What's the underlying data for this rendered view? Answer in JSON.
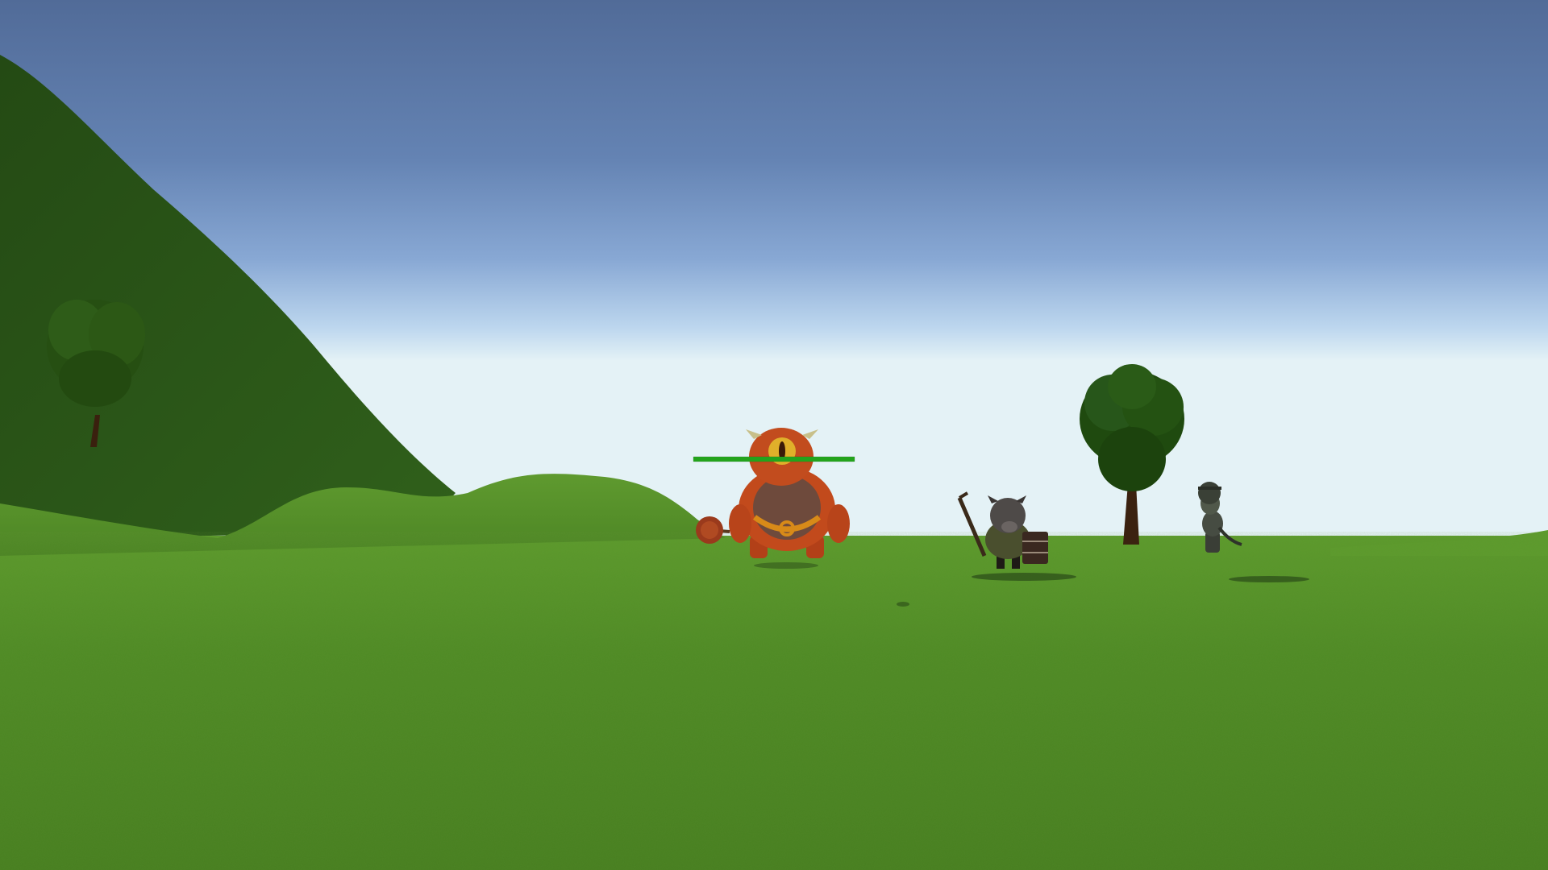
{
  "scene": {
    "sky_top_color": "#54709b",
    "sky_horizon_color": "#d9ecf4",
    "ground_color": "#4f8c24",
    "hill_color": "#284f17"
  },
  "entities": [
    {
      "name": "cyclops-ogre-enemy",
      "kind": "enemy",
      "weapon": "spiked-mace"
    },
    {
      "name": "boar-warrior-enemy",
      "kind": "enemy",
      "weapon": "staff-and-shield"
    },
    {
      "name": "armored-ghoul-enemy",
      "kind": "enemy"
    }
  ],
  "hud": {
    "target_health_fraction": 1.0,
    "health_bar_color": "#23a31c"
  }
}
